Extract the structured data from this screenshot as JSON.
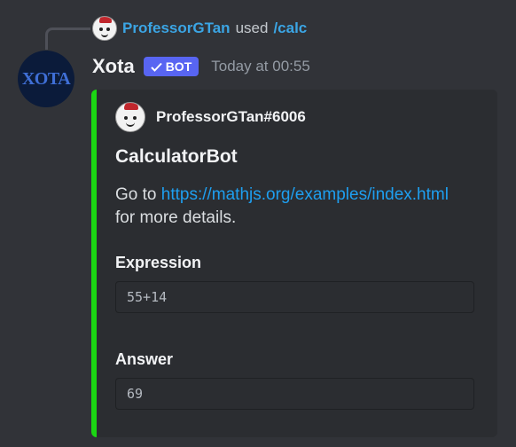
{
  "reply": {
    "username": "ProfessorGTan",
    "verb": "used",
    "command": "/calc"
  },
  "message": {
    "avatar_text": "XOTA",
    "username": "Xota",
    "bot_tag": "BOT",
    "timestamp": "Today at 00:55"
  },
  "embed": {
    "accent_color": "#1bd613",
    "author": "ProfessorGTan#6006",
    "title": "CalculatorBot",
    "description_prefix": "Go to ",
    "description_link": "https://mathjs.org/examples/index.html",
    "description_suffix": " for more details.",
    "fields": [
      {
        "name": "Expression",
        "value": "55+14"
      },
      {
        "name": "Answer",
        "value": "69"
      }
    ]
  },
  "colors": {
    "background": "#313338",
    "embed_bg": "#2b2d31",
    "link": "#1e9ff0",
    "bot_tag": "#5865f2"
  }
}
